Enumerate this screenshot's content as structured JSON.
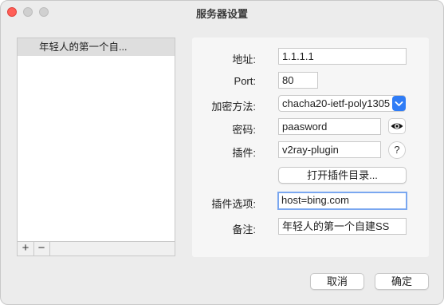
{
  "window": {
    "title": "服务器设置"
  },
  "server_list": {
    "items": [
      {
        "label": "年轻人的第一个自..."
      }
    ],
    "add_label": "+",
    "remove_label": "−"
  },
  "form": {
    "address": {
      "label": "地址:",
      "value": "1.1.1.1"
    },
    "port": {
      "label": "Port:",
      "value": "80"
    },
    "encryption": {
      "label": "加密方法:",
      "value": "chacha20-ietf-poly1305"
    },
    "password": {
      "label": "密码:",
      "value": "paasword"
    },
    "plugin": {
      "label": "插件:",
      "value": "v2ray-plugin"
    },
    "help_label": "?",
    "open_plugin_dir_label": "打开插件目录...",
    "plugin_options": {
      "label": "插件选项:",
      "value": "host=bing.com"
    },
    "remark": {
      "label": "备注:",
      "value": "年轻人的第一个自建SS"
    }
  },
  "footer": {
    "cancel_label": "取消",
    "ok_label": "确定"
  },
  "colors": {
    "accent": "#2f7cf6",
    "focus_ring": "#7aa7f0",
    "close_button": "#ff5f57"
  },
  "icons": {
    "select": "chevron-updown-icon",
    "password_toggle": "eye-icon"
  }
}
